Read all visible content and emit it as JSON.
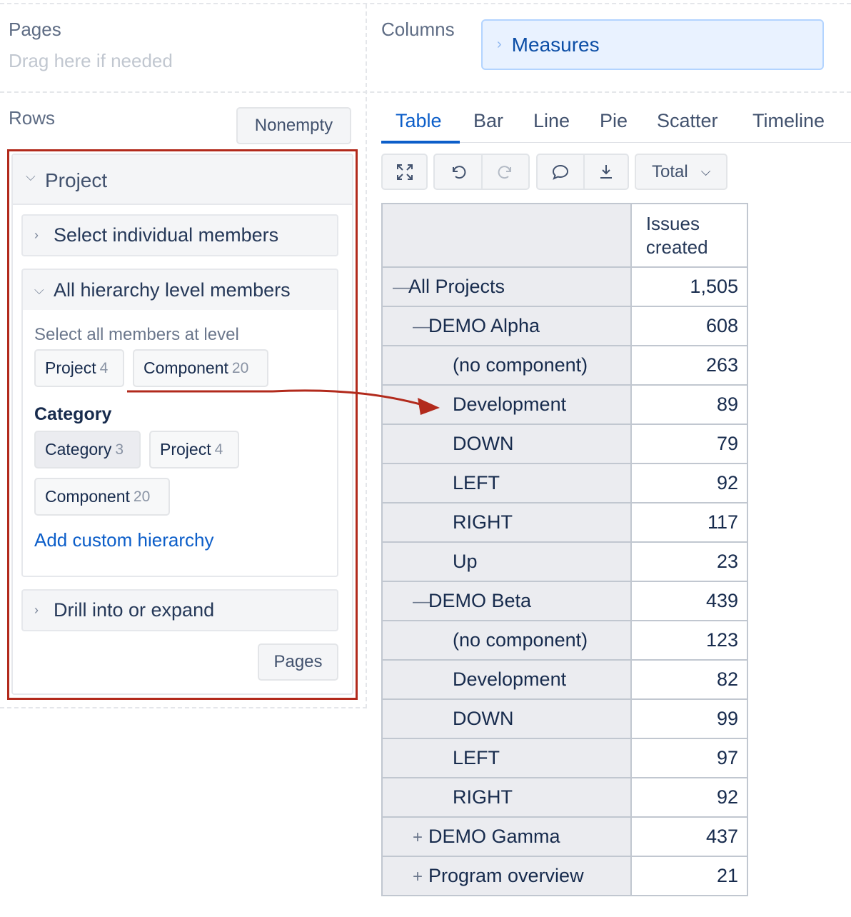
{
  "pages": {
    "label": "Pages",
    "placeholder": "Drag here if needed"
  },
  "columns": {
    "label": "Columns",
    "chip": "Measures"
  },
  "rows": {
    "label": "Rows",
    "nonempty_button": "Nonempty",
    "project_panel": {
      "title": "Project",
      "select_individual": "Select individual members",
      "all_hierarchy": {
        "title": "All hierarchy level members",
        "select_all_label": "Select all members at level",
        "levels": [
          {
            "name": "Project",
            "count": "4"
          },
          {
            "name": "Component",
            "count": "20"
          }
        ],
        "category_heading": "Category",
        "category_levels": [
          {
            "name": "Category",
            "count": "3"
          },
          {
            "name": "Project",
            "count": "4"
          },
          {
            "name": "Component",
            "count": "20"
          }
        ],
        "add_custom": "Add custom hierarchy"
      },
      "drill": "Drill into or expand",
      "pages_button": "Pages"
    }
  },
  "tabs": [
    "Table",
    "Bar",
    "Line",
    "Pie",
    "Scatter",
    "Timeline"
  ],
  "toolbar": {
    "icons": [
      "expand-icon",
      "undo-icon",
      "redo-icon",
      "comment-icon",
      "download-icon"
    ],
    "total_dropdown": "Total"
  },
  "table": {
    "header": "Issues created",
    "header_lines": [
      "Issues",
      "created"
    ],
    "rows": [
      {
        "toggle": "—",
        "name": "All Projects",
        "value": "1,505"
      },
      {
        "toggle": "—",
        "name": "DEMO Alpha",
        "value": "608"
      },
      {
        "toggle": "",
        "name": "(no component)",
        "value": "263"
      },
      {
        "toggle": "",
        "name": "Development",
        "value": "89"
      },
      {
        "toggle": "",
        "name": "DOWN",
        "value": "79"
      },
      {
        "toggle": "",
        "name": "LEFT",
        "value": "92"
      },
      {
        "toggle": "",
        "name": "RIGHT",
        "value": "117"
      },
      {
        "toggle": "",
        "name": "Up",
        "value": "23"
      },
      {
        "toggle": "—",
        "name": "DEMO Beta",
        "value": "439"
      },
      {
        "toggle": "",
        "name": "(no component)",
        "value": "123"
      },
      {
        "toggle": "",
        "name": "Development",
        "value": "82"
      },
      {
        "toggle": "",
        "name": "DOWN",
        "value": "99"
      },
      {
        "toggle": "",
        "name": "LEFT",
        "value": "97"
      },
      {
        "toggle": "",
        "name": "RIGHT",
        "value": "92"
      },
      {
        "toggle": "+",
        "name": "DEMO Gamma",
        "value": "437"
      },
      {
        "toggle": "+",
        "name": "Program overview",
        "value": "21"
      }
    ]
  },
  "colors": {
    "accent": "#0c5ec9",
    "highlight_border": "#b22a1c",
    "arrow": "#b22a1c"
  }
}
